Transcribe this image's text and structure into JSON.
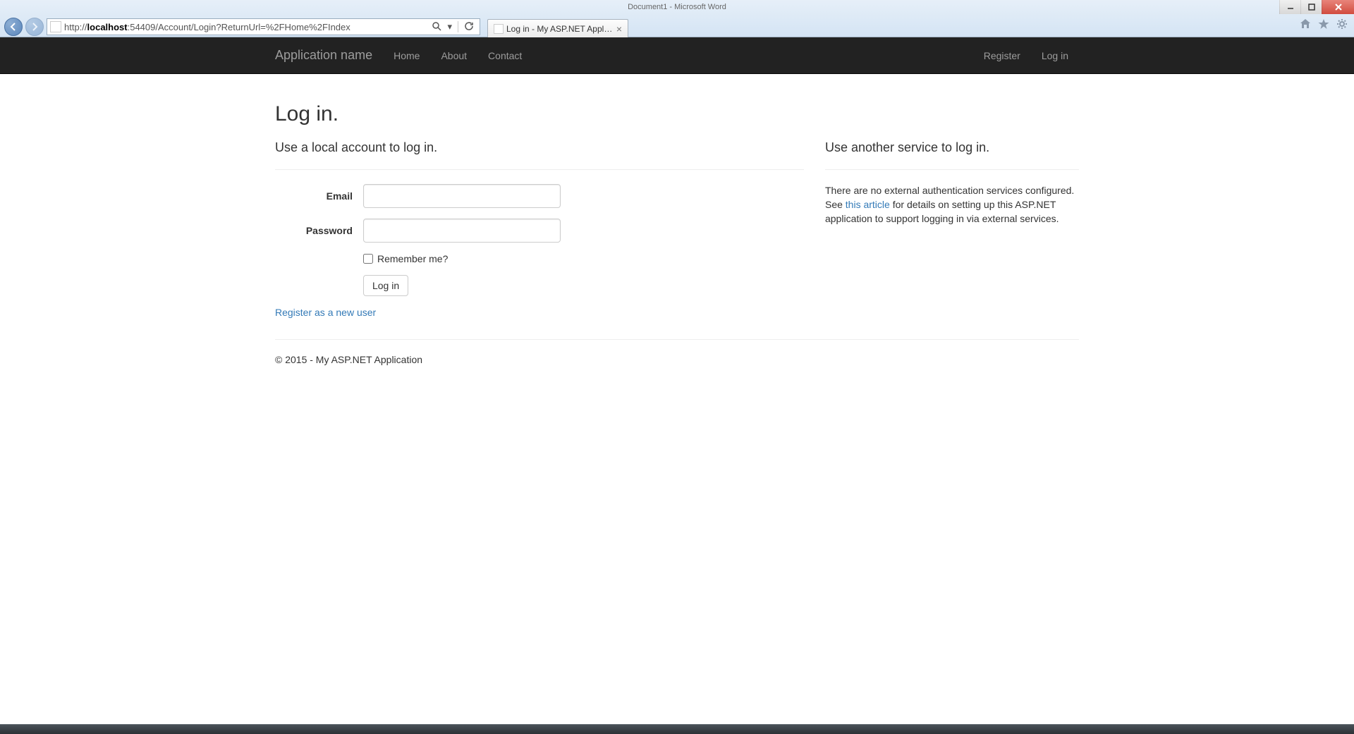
{
  "browser": {
    "backgroundTitle": "Document1 - Microsoft Word",
    "url_prefix": "http://",
    "url_host": "localhost",
    "url_path": ":54409/Account/Login?ReturnUrl=%2FHome%2FIndex",
    "tabTitle": "Log in - My ASP.NET Applic..."
  },
  "navbar": {
    "brand": "Application name",
    "leftLinks": [
      "Home",
      "About",
      "Contact"
    ],
    "rightLinks": [
      "Register",
      "Log in"
    ]
  },
  "page": {
    "title": "Log in.",
    "localHeading": "Use a local account to log in.",
    "emailLabel": "Email",
    "passwordLabel": "Password",
    "rememberLabel": "Remember me?",
    "loginButton": "Log in",
    "registerLink": "Register as a new user",
    "externalHeading": "Use another service to log in.",
    "externalText1": "There are no external authentication services configured. See ",
    "externalLink": "this article",
    "externalText2": " for details on setting up this ASP.NET application to support logging in via external services."
  },
  "footer": "© 2015 - My ASP.NET Application"
}
